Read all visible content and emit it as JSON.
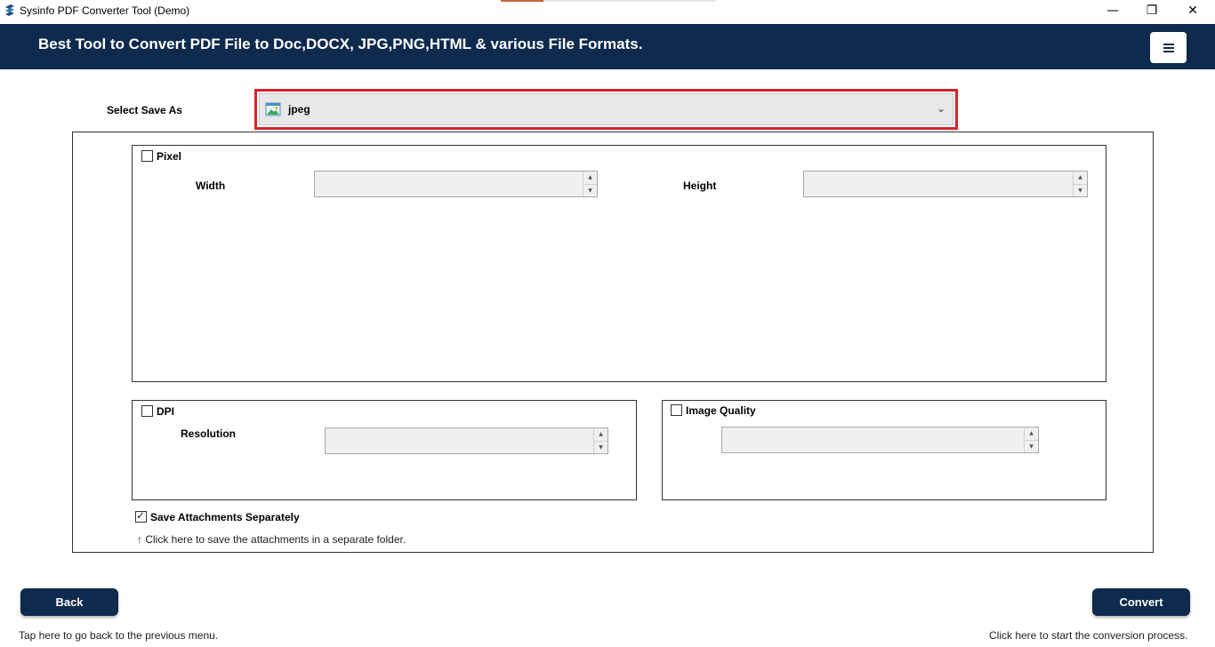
{
  "window": {
    "title": "Sysinfo PDF Converter Tool (Demo)",
    "minimize": "—",
    "maximize": "❐",
    "close": "✕"
  },
  "banner": {
    "headline": "Best Tool to Convert PDF File to Doc,DOCX, JPG,PNG,HTML & various File Formats."
  },
  "save_as": {
    "label": "Select Save As",
    "selected": "jpeg",
    "icon": "image-file-icon"
  },
  "pixel": {
    "label": "Pixel",
    "checked": false,
    "width_label": "Width",
    "height_label": "Height",
    "width_value": "",
    "height_value": ""
  },
  "dpi": {
    "label": "DPI",
    "checked": false,
    "resolution_label": "Resolution",
    "resolution_value": ""
  },
  "image_quality": {
    "label": "Image Quality",
    "checked": false,
    "value": ""
  },
  "attachments": {
    "label": "Save Attachments Separately",
    "checked": true,
    "hint": "↑ Click here to save the attachments in a separate folder."
  },
  "footer": {
    "back_label": "Back",
    "back_hint": "Tap here to go back to the previous menu.",
    "convert_label": "Convert",
    "convert_hint": "Click here to start the conversion process."
  },
  "colors": {
    "brand": "#0e2a4d",
    "highlight": "#d8232a"
  }
}
